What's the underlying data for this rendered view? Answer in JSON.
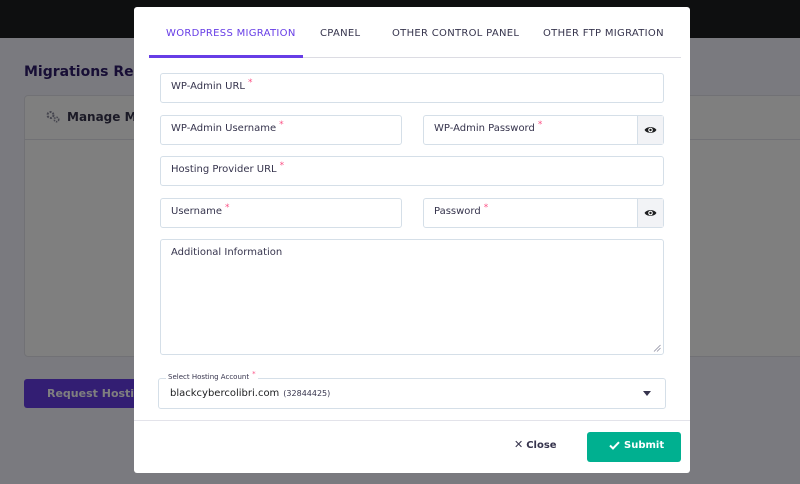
{
  "background": {
    "title": "Migrations Requ",
    "card_title": "Manage Mig",
    "button_label": "Request Hosting M"
  },
  "tabs": [
    {
      "label": "WORDPRESS MIGRATION",
      "active": true
    },
    {
      "label": "CPANEL",
      "active": false
    },
    {
      "label": "OTHER CONTROL PANEL",
      "active": false
    },
    {
      "label": "OTHER FTP MIGRATION",
      "active": false
    }
  ],
  "form": {
    "required_mark": "*",
    "wp_admin_url": {
      "label": "WP-Admin URL",
      "value": ""
    },
    "wp_admin_username": {
      "label": "WP-Admin Username",
      "value": ""
    },
    "wp_admin_password": {
      "label": "WP-Admin Password",
      "value": ""
    },
    "hosting_provider_url": {
      "label": "Hosting Provider URL",
      "value": ""
    },
    "username": {
      "label": "Username",
      "value": ""
    },
    "password": {
      "label": "Password",
      "value": ""
    },
    "additional_info": {
      "label": "Additional Information",
      "value": ""
    },
    "hosting_account": {
      "label": "Select Hosting Account",
      "selected": "blackcybercolibri.com",
      "selected_id": "(32844425)"
    }
  },
  "footer": {
    "close_label": "Close",
    "submit_label": "Submit"
  },
  "colors": {
    "accent": "#673de6",
    "success": "#00b090",
    "required": "#fc5185",
    "topbar": "#1d1e20"
  },
  "icons": {
    "password_toggle": "eye-icon",
    "close": "x-icon",
    "submit": "check-icon",
    "select": "caret-down-icon",
    "card": "gear-icon"
  }
}
